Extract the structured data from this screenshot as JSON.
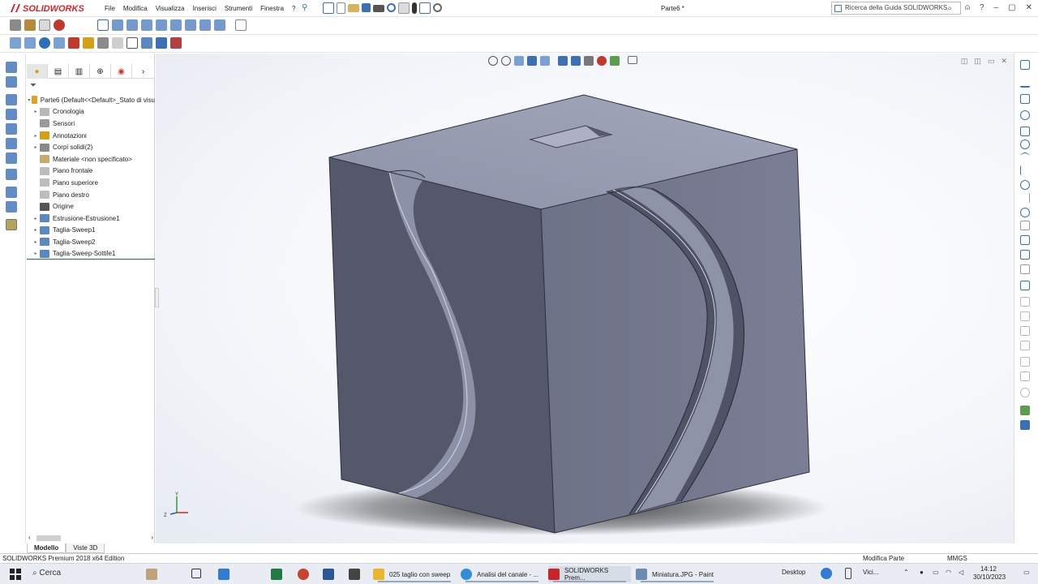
{
  "app": {
    "brand": "SOLIDWORKS",
    "document_title": "Parte6 *",
    "menu": [
      "File",
      "Modifica",
      "Visualizza",
      "Inserisci",
      "Strumenti",
      "Finestra",
      "?"
    ],
    "search_placeholder": "Ricerca della Guida SOLIDWORKS"
  },
  "feature_manager": {
    "root": "Parte6  (Default<<Default>_Stato di visu",
    "items": [
      {
        "label": "Cronologia",
        "expandable": true
      },
      {
        "label": "Sensori",
        "expandable": false
      },
      {
        "label": "Annotazioni",
        "expandable": true
      },
      {
        "label": "Corpi solidi(2)",
        "expandable": true
      },
      {
        "label": "Materiale <non specificato>",
        "expandable": false
      },
      {
        "label": "Piano frontale",
        "expandable": false
      },
      {
        "label": "Piano superiore",
        "expandable": false
      },
      {
        "label": "Piano destro",
        "expandable": false
      },
      {
        "label": "Origine",
        "expandable": false
      },
      {
        "label": "Estrusione-Estrusione1",
        "expandable": true
      },
      {
        "label": "Taglia-Sweep1",
        "expandable": true
      },
      {
        "label": "Taglia-Sweep2",
        "expandable": true
      },
      {
        "label": "Taglia-Sweep-Sottile1",
        "expandable": true
      }
    ]
  },
  "bottom_tabs": [
    "Modello",
    "Viste 3D"
  ],
  "status_bar": {
    "edition": "SOLIDWORKS Premium 2018 x64 Edition",
    "mode": "Modifica Parte",
    "units": "MMGS"
  },
  "taskbar": {
    "search_label": "Cerca",
    "apps": [
      {
        "label": "025 taglio con sweep",
        "color": "#e8b730"
      },
      {
        "label": "Analisi del canale - ...",
        "color": "#2f8fdb"
      },
      {
        "label": "SOLIDWORKS Prem...",
        "color": "#c7252b"
      },
      {
        "label": "Miniatura.JPG - Paint",
        "color": "#6b8bb5"
      }
    ],
    "desktop_label": "Desktop",
    "weather_label": "Vici...",
    "time": "14:12",
    "date": "30/10/2023"
  },
  "colors": {
    "accent_blue": "#2d5aa6",
    "brand_red": "#d8232a",
    "model_face_top": "#9195aa",
    "model_face_left": "#55586a",
    "model_face_right": "#70738a"
  }
}
